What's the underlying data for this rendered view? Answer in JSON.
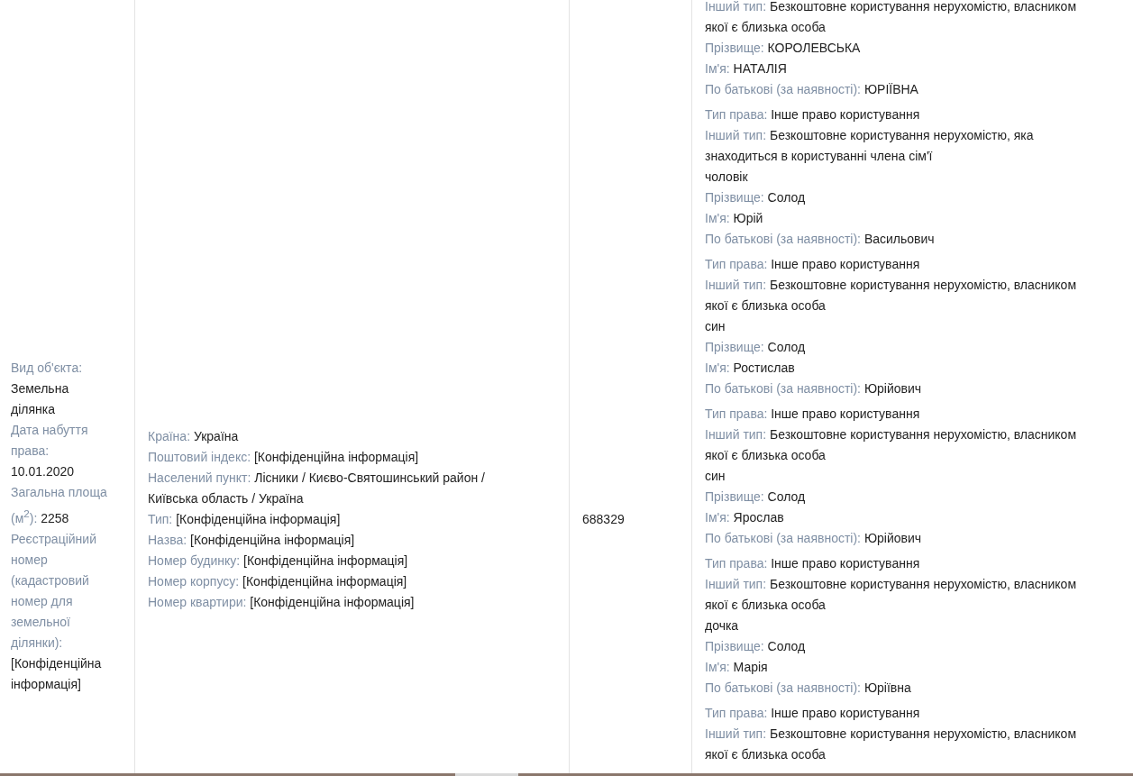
{
  "object_cell": {
    "fields": [
      {
        "label": "Вид об'єкта:",
        "value": "Земельна ділянка"
      },
      {
        "label": "Дата набуття права:",
        "value": "10.01.2020"
      },
      {
        "label": "Загальна площа (м$^{2}$):",
        "value": "2258"
      },
      {
        "label": "Реєстраційний номер (кадастровий номер для земельної ділянки):",
        "value": "[Конфіденційна інформація]"
      }
    ]
  },
  "address_cell": {
    "fields": [
      {
        "label": "Країна:",
        "value": "Україна"
      },
      {
        "label": "Поштовий індекс:",
        "value": "[Конфіденційна інформація]"
      },
      {
        "label": "Населений пункт:",
        "value": "Лісники / Києво-Святошинський район / Київська область / Україна"
      },
      {
        "label": "Тип:",
        "value": "[Конфіденційна інформація]"
      },
      {
        "label": "Назва:",
        "value": "[Конфіденційна інформація]"
      },
      {
        "label": "Номер будинку:",
        "value": "[Конфіденційна інформація]"
      },
      {
        "label": "Номер корпусу:",
        "value": "[Конфіденційна інформація]"
      },
      {
        "label": "Номер квартири:",
        "value": "[Конфіденційна інформація]"
      }
    ]
  },
  "cost_cell": {
    "value": "688329"
  },
  "rights_cell": {
    "blocks": [
      {
        "fields": [
          {
            "label": "Інший тип:",
            "value": "Безкоштовне користування нерухомістю, власником якої є близька особа"
          },
          {
            "label": "Прізвище:",
            "value": "КОРОЛЕВСЬКА"
          },
          {
            "label": "Ім'я:",
            "value": "НАТАЛІЯ"
          },
          {
            "label": "По батькові (за наявності):",
            "value": "ЮРІЇВНА"
          }
        ]
      },
      {
        "fields": [
          {
            "label": "Тип права:",
            "value": "Інше право користування"
          },
          {
            "label": "Інший тип:",
            "value": "Безкоштовне користування нерухомістю, яка знаходиться в користуванні члена сім'ї"
          },
          {
            "value": "чоловік"
          },
          {
            "label": "Прізвище:",
            "value": "Солод"
          },
          {
            "label": "Ім'я:",
            "value": "Юрій"
          },
          {
            "label": "По батькові (за наявності):",
            "value": "Васильович"
          }
        ]
      },
      {
        "fields": [
          {
            "label": "Тип права:",
            "value": "Інше право користування"
          },
          {
            "label": "Інший тип:",
            "value": "Безкоштовне користування нерухомістю, власником якої є близька особа"
          },
          {
            "value": "син"
          },
          {
            "label": "Прізвище:",
            "value": "Солод"
          },
          {
            "label": "Ім'я:",
            "value": "Ростислав"
          },
          {
            "label": "По батькові (за наявності):",
            "value": "Юрійович"
          }
        ]
      },
      {
        "fields": [
          {
            "label": "Тип права:",
            "value": "Інше право користування"
          },
          {
            "label": "Інший тип:",
            "value": "Безкоштовне користування нерухомістю, власником якої є близька особа"
          },
          {
            "value": "син"
          },
          {
            "label": "Прізвище:",
            "value": "Солод"
          },
          {
            "label": "Ім'я:",
            "value": "Ярослав"
          },
          {
            "label": "По батькові (за наявності):",
            "value": "Юрійович"
          }
        ]
      },
      {
        "fields": [
          {
            "label": "Тип права:",
            "value": "Інше право користування"
          },
          {
            "label": "Інший тип:",
            "value": "Безкоштовне користування нерухомістю, власником якої є близька особа"
          },
          {
            "value": "дочка"
          },
          {
            "label": "Прізвище:",
            "value": "Солод"
          },
          {
            "label": "Ім'я:",
            "value": "Марія"
          },
          {
            "label": "По батькові (за наявності):",
            "value": "Юріївна"
          }
        ]
      },
      {
        "fields": [
          {
            "label": "Тип права:",
            "value": "Інше право користування"
          },
          {
            "label": "Інший тип:",
            "value": "Безкоштовне користування нерухомістю, власником якої є близька особа"
          }
        ]
      }
    ]
  }
}
